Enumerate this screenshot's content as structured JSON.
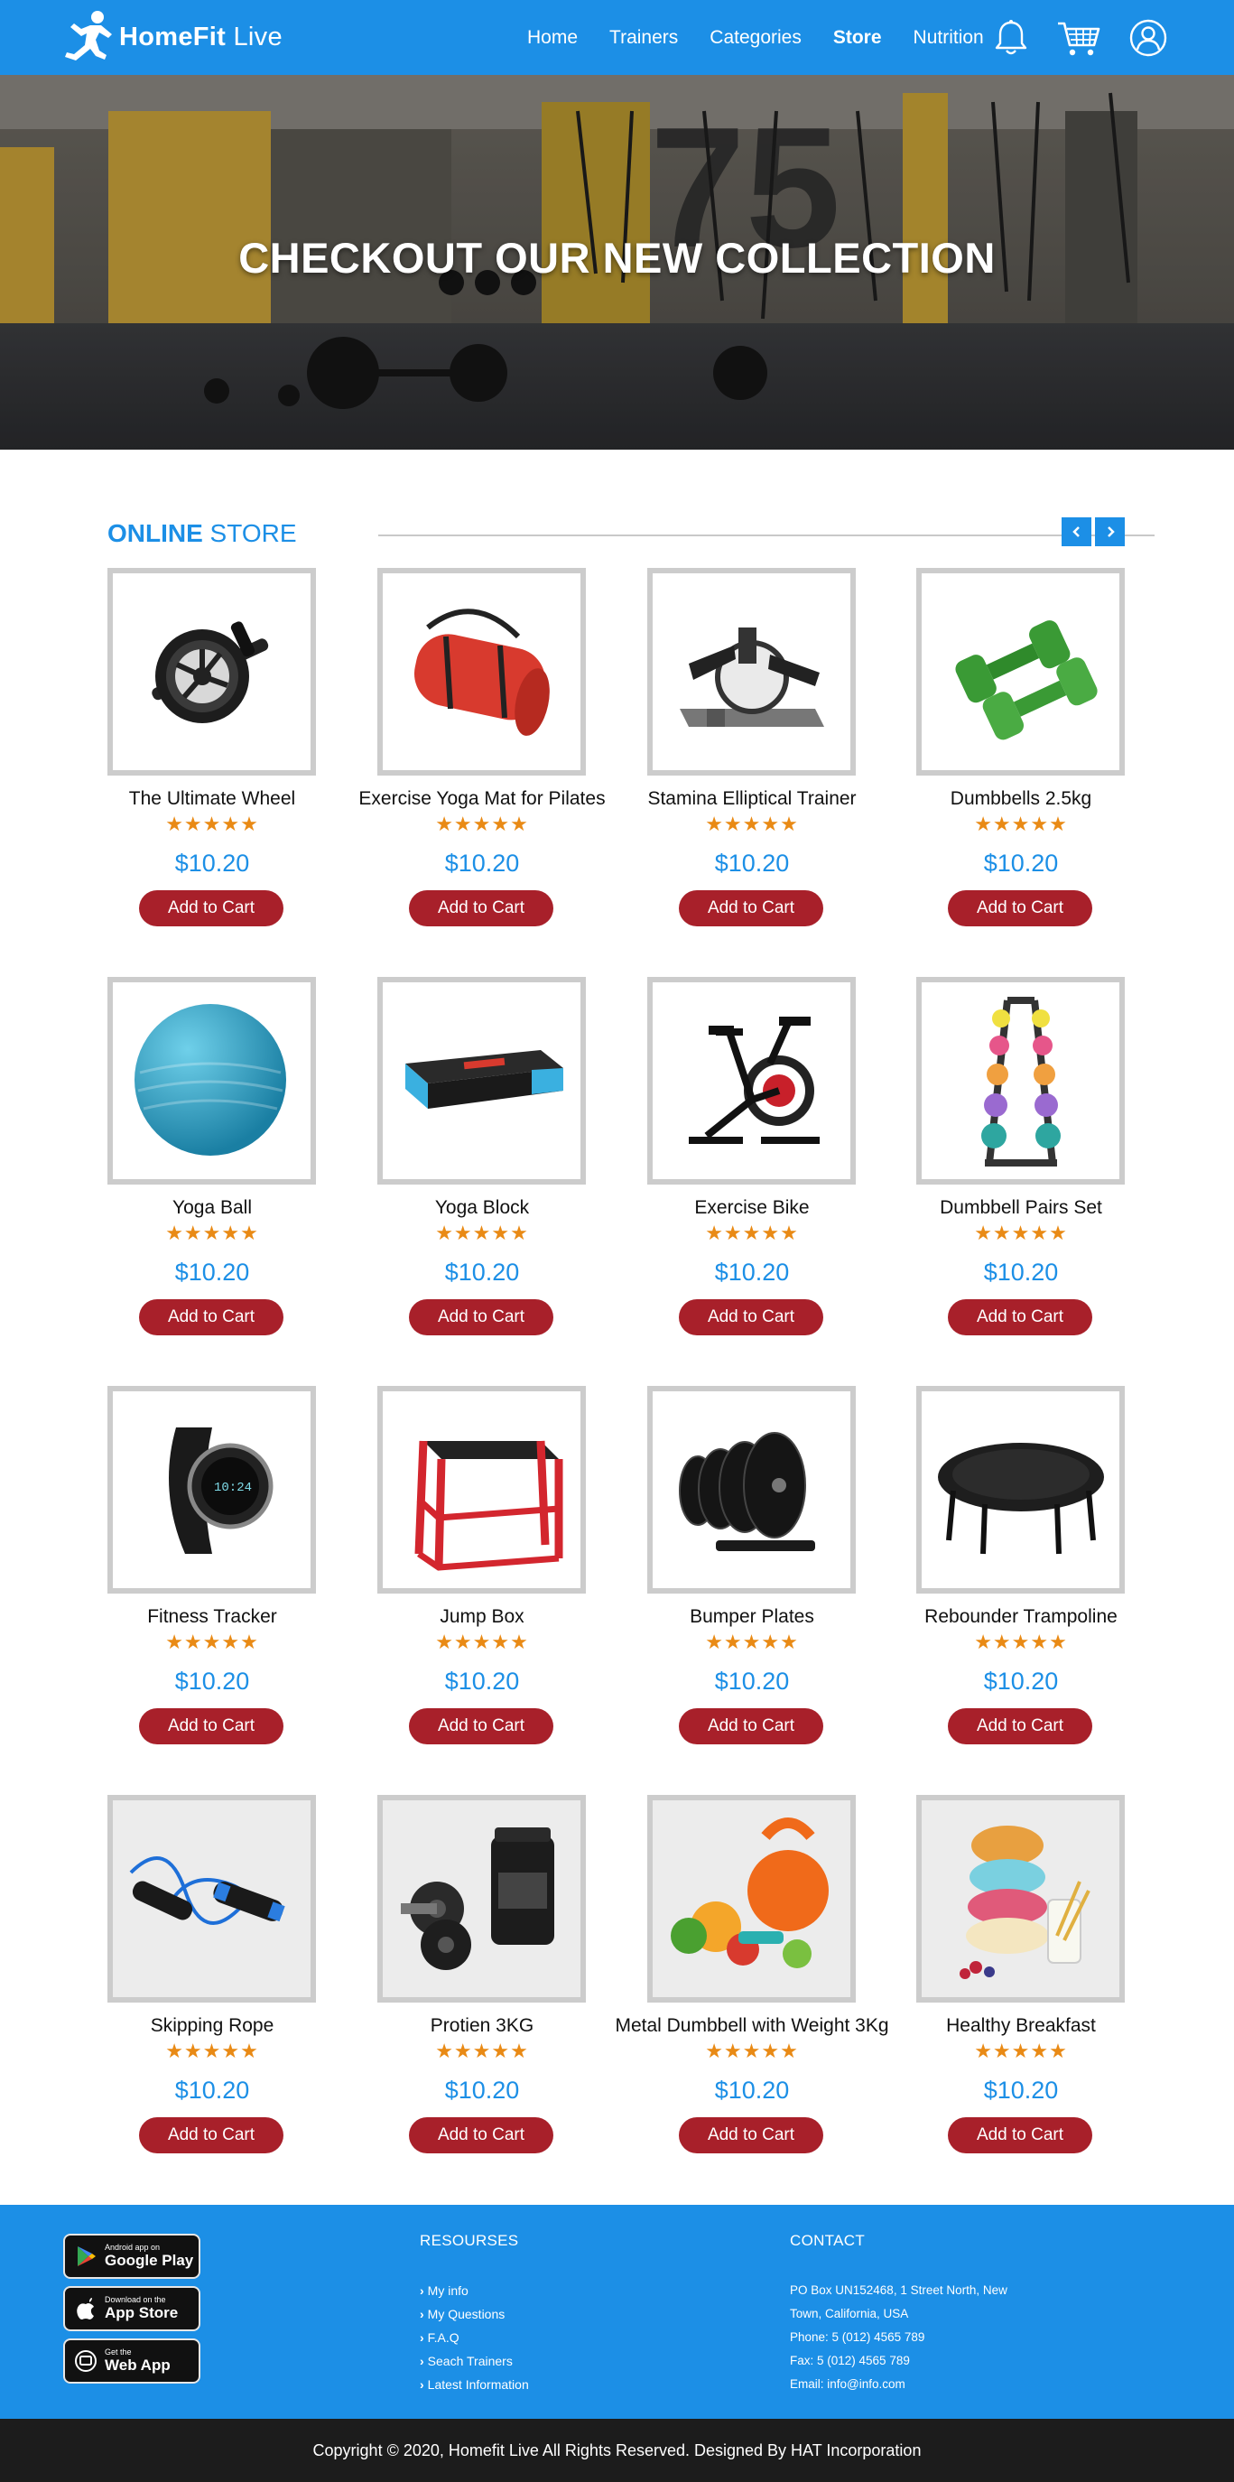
{
  "brand": {
    "name_bold": "HomeFit",
    "name_light": " Live"
  },
  "nav": {
    "links": [
      "Home",
      "Trainers",
      "Categories",
      "Store",
      "Nutrition"
    ],
    "active": "Store"
  },
  "hero": {
    "title": "CHECKOUT OUR NEW COLLECTION"
  },
  "store": {
    "title_bold": "ONLINE",
    "title_light": " STORE",
    "prev_icon": "chevron-left-icon",
    "next_icon": "chevron-right-icon"
  },
  "products": [
    {
      "name": "The Ultimate Wheel",
      "rating": 5,
      "stars": "★★★★★",
      "price": "$10.20",
      "cta": "Add to Cart",
      "image": "ab-wheel"
    },
    {
      "name": "Exercise Yoga Mat for Pilates",
      "rating": 5,
      "stars": "★★★★★",
      "price": "$10.20",
      "cta": "Add to Cart",
      "image": "yoga-mat"
    },
    {
      "name": "Stamina Elliptical Trainer",
      "rating": 5,
      "stars": "★★★★★",
      "price": "$10.20",
      "cta": "Add to Cart",
      "image": "elliptical"
    },
    {
      "name": "Dumbbells 2.5kg",
      "rating": 5,
      "stars": "★★★★★",
      "price": "$10.20",
      "cta": "Add to Cart",
      "image": "green-dumbbells"
    },
    {
      "name": "Yoga Ball",
      "rating": 5,
      "stars": "★★★★★",
      "price": "$10.20",
      "cta": "Add to Cart",
      "image": "yoga-ball"
    },
    {
      "name": "Yoga Block",
      "rating": 5,
      "stars": "★★★★★",
      "price": "$10.20",
      "cta": "Add to Cart",
      "image": "step-block"
    },
    {
      "name": "Exercise Bike",
      "rating": 5,
      "stars": "★★★★★",
      "price": "$10.20",
      "cta": "Add to Cart",
      "image": "bike"
    },
    {
      "name": "Dumbbell Pairs Set",
      "rating": 5,
      "stars": "★★★★★",
      "price": "$10.20",
      "cta": "Add to Cart",
      "image": "dumbbell-rack"
    },
    {
      "name": "Fitness Tracker",
      "rating": 5,
      "stars": "★★★★★",
      "price": "$10.20",
      "cta": "Add to Cart",
      "image": "tracker"
    },
    {
      "name": "Jump Box",
      "rating": 5,
      "stars": "★★★★★",
      "price": "$10.20",
      "cta": "Add to Cart",
      "image": "jump-box"
    },
    {
      "name": "Bumper Plates",
      "rating": 5,
      "stars": "★★★★★",
      "price": "$10.20",
      "cta": "Add to Cart",
      "image": "plates"
    },
    {
      "name": "Rebounder Trampoline",
      "rating": 5,
      "stars": "★★★★★",
      "price": "$10.20",
      "cta": "Add to Cart",
      "image": "trampoline"
    },
    {
      "name": "Skipping Rope",
      "rating": 5,
      "stars": "★★★★★",
      "price": "$10.20",
      "cta": "Add to Cart",
      "image": "rope"
    },
    {
      "name": "Protien 3KG",
      "rating": 5,
      "stars": "★★★★★",
      "price": "$10.20",
      "cta": "Add to Cart",
      "image": "protein"
    },
    {
      "name": "Metal Dumbbell with Weight 3Kg",
      "rating": 5,
      "stars": "★★★★★",
      "price": "$10.20",
      "cta": "Add to Cart",
      "image": "kettlebell"
    },
    {
      "name": "Healthy Breakfast",
      "rating": 5,
      "stars": "★★★★★",
      "price": "$10.20",
      "cta": "Add to Cart",
      "image": "breakfast"
    }
  ],
  "footer": {
    "badges": [
      {
        "small": "Android app on",
        "big": "Google Play",
        "icon": "google-play-icon"
      },
      {
        "small": "Download on the",
        "big": "App Store",
        "icon": "apple-icon"
      },
      {
        "small": "Get the",
        "big": "Web App",
        "icon": "web-app-icon"
      }
    ],
    "resources_title": "RESOURSES",
    "resources": [
      "My info",
      "My Questions",
      "F.A.Q",
      "Seach Trainers",
      "Latest Information"
    ],
    "contact_title": "CONTACT",
    "contact": [
      "PO Box UN152468, 1 Street North, New",
      "Town, California, USA",
      "Phone: 5 (012) 4565 789",
      "Fax: 5 (012) 4565 789",
      "Email: info@info.com"
    ],
    "copyright": "Copyright © 2020, Homefit Live All Rights Reserved. Designed By HAT Incorporation"
  },
  "colors": {
    "primary": "#1c8fe6",
    "cta": "#a8202a",
    "star": "#e98a15",
    "dark": "#1c1c1c"
  }
}
